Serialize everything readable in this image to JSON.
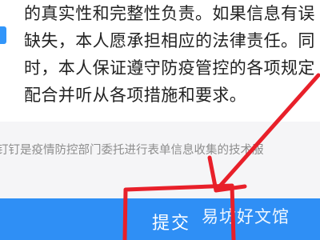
{
  "declaration": {
    "lines": [
      "的真实性和完整性负责。如果信息有误",
      "缺失，本人愿承担相应的法律责任。同",
      "时，本人保证遵守防疫管控的各项规定",
      "配合并听从各项措施和要求。"
    ]
  },
  "disclaimer": "钉钉是疫情防控部门委托进行表单信息收集的技术服",
  "submit_label": "提交",
  "watermark": "易坊好文馆",
  "colors": {
    "primary": "#2f8ff5",
    "annotation": "#e8202a"
  }
}
